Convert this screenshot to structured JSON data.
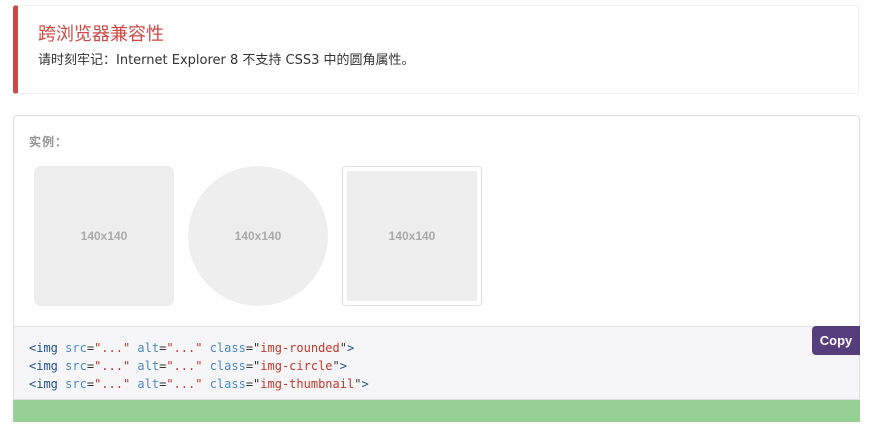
{
  "callout": {
    "title": "跨浏览器兼容性",
    "text": "请时刻牢记：Internet Explorer 8 不支持 CSS3 中的圆角属性。",
    "border_color": "#ce4844"
  },
  "example": {
    "label": "实例：",
    "images": [
      {
        "text": "140x140",
        "style": "rounded"
      },
      {
        "text": "140x140",
        "style": "circle"
      },
      {
        "text": "140x140",
        "style": "thumbnail"
      }
    ]
  },
  "code": {
    "lines": [
      {
        "class_value": "img-rounded"
      },
      {
        "class_value": "img-circle"
      },
      {
        "class_value": "img-thumbnail"
      }
    ],
    "tag_open": "<img",
    "tag_close": ">",
    "attr_src": "src",
    "attr_alt": "alt",
    "attr_class": "class",
    "src_value": "\"...\"",
    "alt_value": "\"...\""
  },
  "copy_button": {
    "label": "Copy",
    "color": "#563d7c"
  },
  "status_bar_color": "#95d095"
}
